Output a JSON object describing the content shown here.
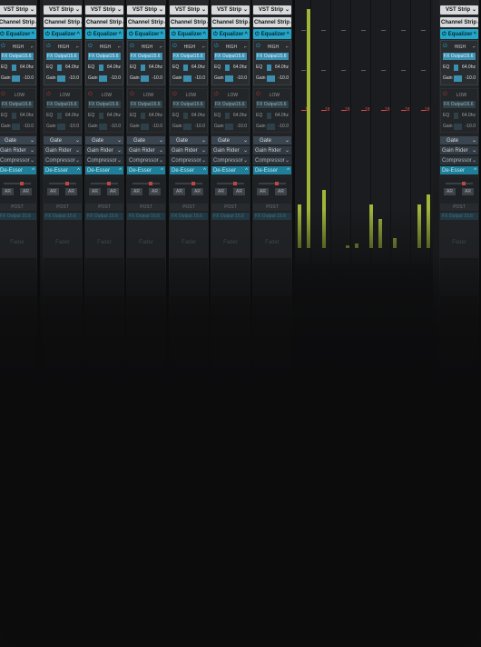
{
  "strip_labels": {
    "vst": "VST Strip",
    "channel": "Channel Strip",
    "equalizer": "Equalizer",
    "band_high": "HIGH",
    "band_low": "LOW",
    "fx_output": "FX Output15.6",
    "eq_label": "EQ",
    "freq": "64.0hz",
    "gain_label": "Gain",
    "gain_value": "-10.0",
    "gate": "Gate",
    "gain_rider": "Gain Rider",
    "compressor": "Compressor",
    "de_esser": "De-Esser",
    "aw_left": "AR",
    "aw_right": "AR",
    "post": "POST",
    "fx_output_lower": "FX Output 15.6",
    "fader": "Fader",
    "chevron_down": "⌄",
    "chevron_up": "^"
  },
  "meter_scale": {
    "top_labels": [
      "-",
      "-",
      "-",
      "-",
      "-",
      "-",
      "-"
    ],
    "red_labels": [
      "18",
      "18",
      "18",
      "18",
      "18",
      "18",
      "18"
    ]
  },
  "meter_levels": [
    0.98,
    0.18,
    0.24,
    0.0,
    0.01,
    0.02,
    0.18,
    0.12,
    0.04,
    0.0,
    0.0,
    0.18,
    0.22
  ],
  "colors": {
    "accent": "#23a6c8",
    "meter": "#a0b53a",
    "clip": "#e04b4b"
  }
}
